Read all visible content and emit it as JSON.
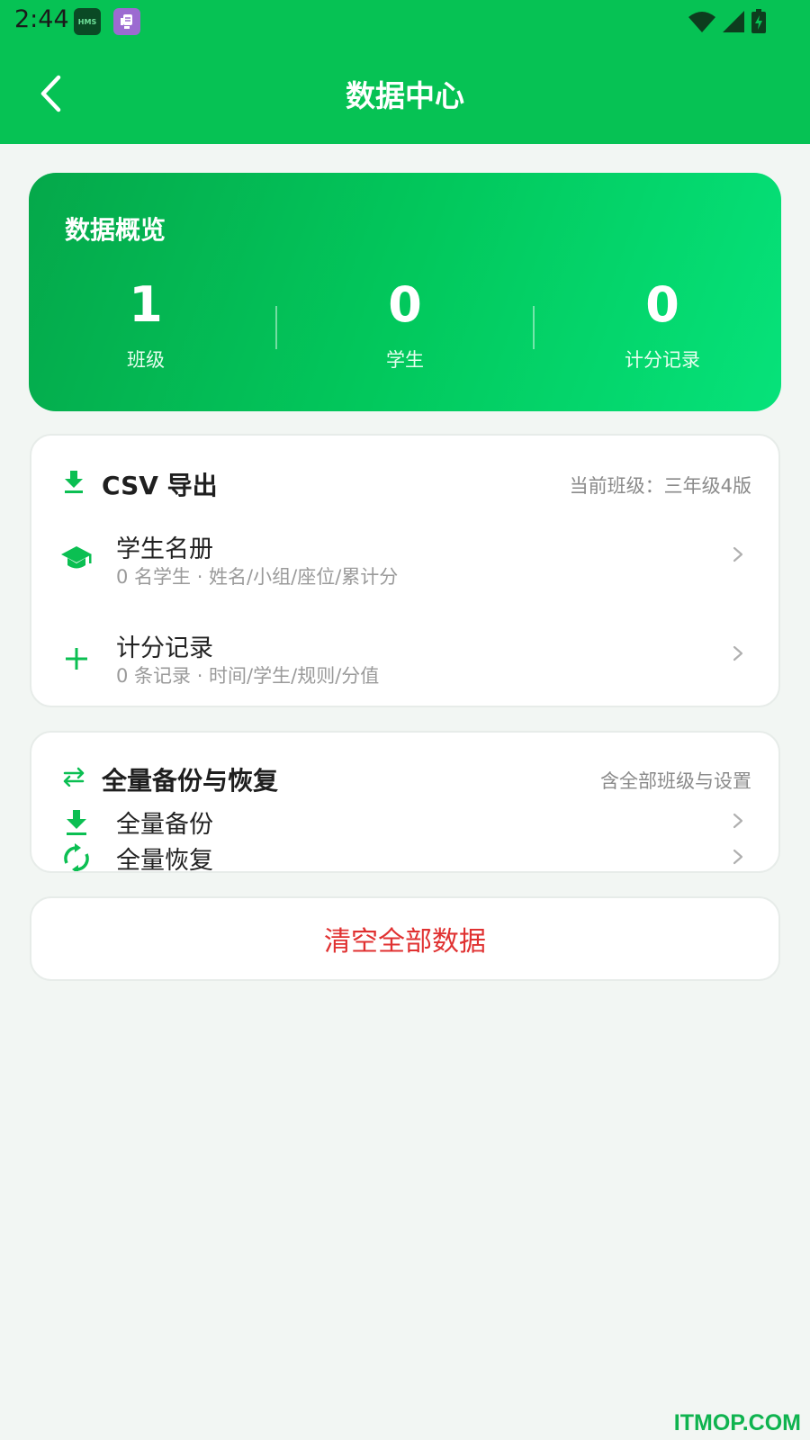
{
  "status": {
    "time": "2:44",
    "hms_label": "HMS"
  },
  "header": {
    "title": "数据中心"
  },
  "overview": {
    "title": "数据概览",
    "stats": [
      {
        "value": "1",
        "label": "班级"
      },
      {
        "value": "0",
        "label": "学生"
      },
      {
        "value": "0",
        "label": "计分记录"
      }
    ]
  },
  "export": {
    "title": "CSV 导出",
    "note": "当前班级：三年级4版",
    "items": [
      {
        "title": "学生名册",
        "subtitle": "0 名学生 · 姓名/小组/座位/累计分",
        "icon": "graduation-cap-icon"
      },
      {
        "title": "计分记录",
        "subtitle": "0 条记录 · 时间/学生/规则/分值",
        "icon": "plus-icon"
      }
    ]
  },
  "backup": {
    "title": "全量备份与恢复",
    "note": "含全部班级与设置",
    "items": [
      {
        "title": "全量备份",
        "icon": "download-icon"
      },
      {
        "title": "全量恢复",
        "icon": "refresh-icon"
      }
    ]
  },
  "clear": {
    "label": "清空全部数据"
  },
  "watermark": "ITMOP.COM",
  "colors": {
    "brand": "#06c254",
    "danger": "#e03131",
    "background": "#f2f6f3"
  }
}
